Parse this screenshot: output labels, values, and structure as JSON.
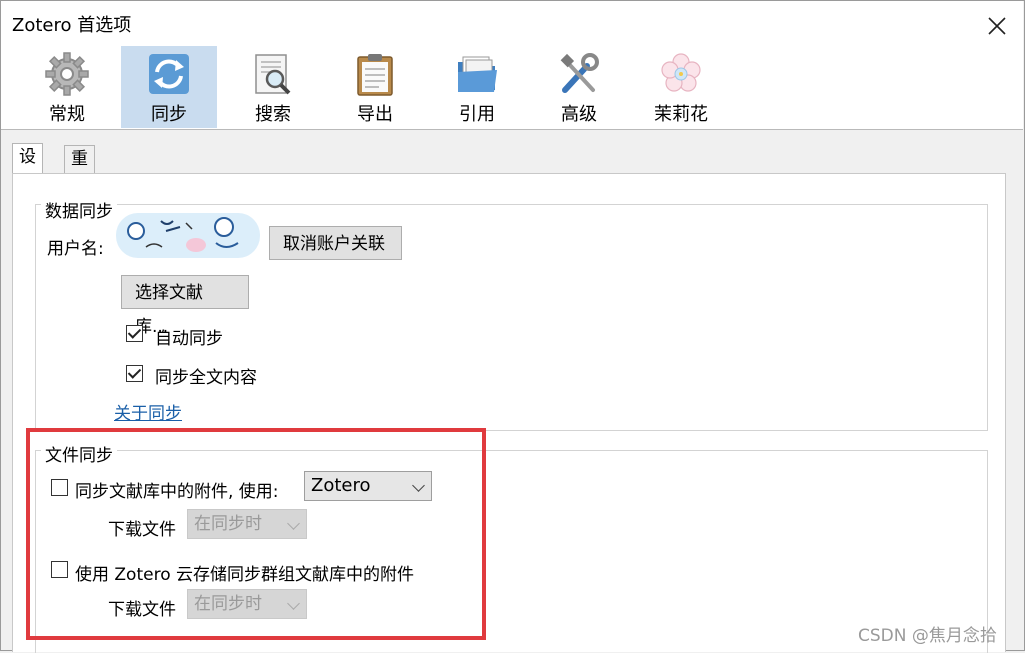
{
  "window": {
    "title": "Zotero 首选项"
  },
  "toolbar": {
    "items": [
      {
        "label": "常规",
        "icon": "gear-icon"
      },
      {
        "label": "同步",
        "icon": "sync-icon",
        "selected": true
      },
      {
        "label": "搜索",
        "icon": "search-icon"
      },
      {
        "label": "导出",
        "icon": "clipboard-icon"
      },
      {
        "label": "引用",
        "icon": "folder-icon"
      },
      {
        "label": "高级",
        "icon": "tools-icon"
      },
      {
        "label": "茉莉花",
        "icon": "flower-icon"
      }
    ]
  },
  "tabs": [
    {
      "label": "设置",
      "active": true
    },
    {
      "label": "重置",
      "active": false
    }
  ],
  "data_sync": {
    "legend": "数据同步",
    "username_label": "用户名:",
    "unlink_button": "取消账户关联",
    "choose_libraries_button": "选择文献库...",
    "auto_sync": {
      "label": "自动同步",
      "checked": true
    },
    "fulltext_sync": {
      "label": "同步全文内容",
      "checked": true
    },
    "about_link": "关于同步"
  },
  "file_sync": {
    "legend": "文件同步",
    "library_attachments": {
      "label": "同步文献库中的附件, 使用:",
      "checked": false,
      "service": "Zotero"
    },
    "download_label_1": "下载文件",
    "download_mode_1": "在同步时",
    "group_attachments": {
      "label": "使用 Zotero 云存储同步群组文献库中的附件",
      "checked": false
    },
    "download_label_2": "下载文件",
    "download_mode_2": "在同步时"
  },
  "watermark": "CSDN @焦月念拾",
  "colors": {
    "highlight_box": "#e03a3e",
    "selected_tool": "#c9dcef",
    "link": "#1a5fa8"
  }
}
